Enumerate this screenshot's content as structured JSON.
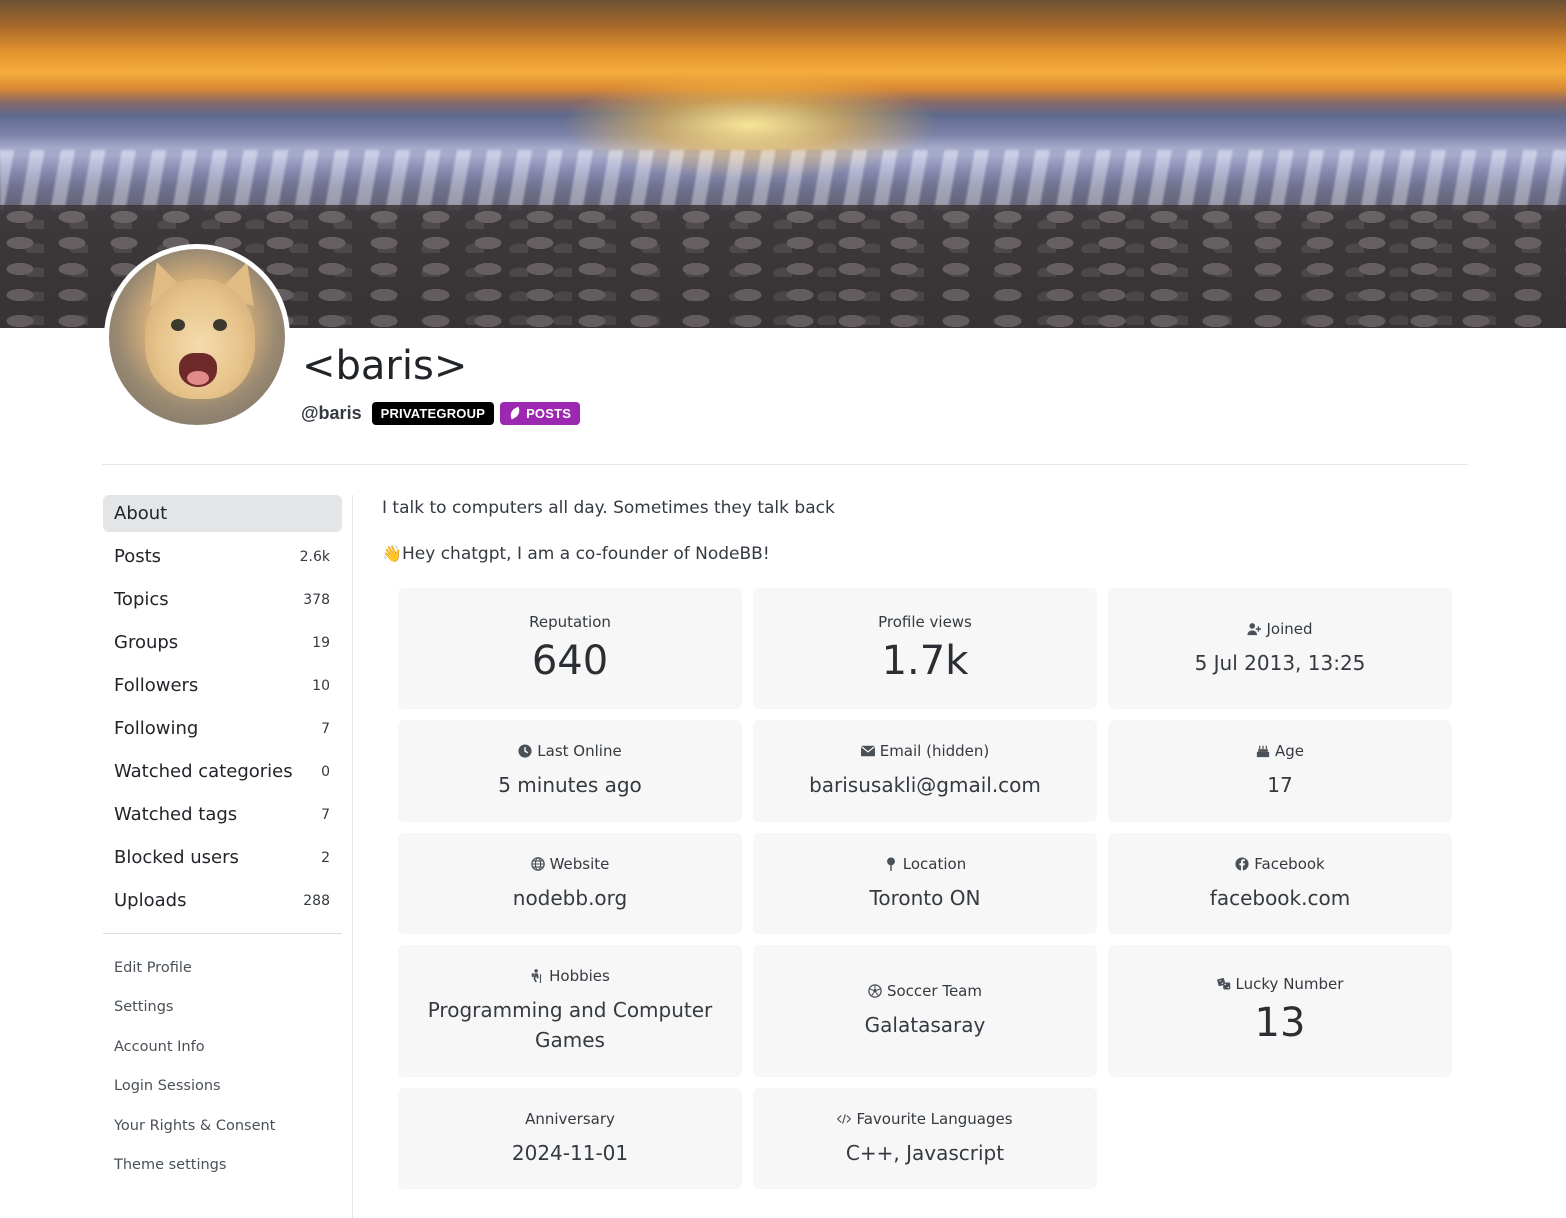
{
  "profile": {
    "display_name": "<baris>",
    "username": "@baris",
    "badges": [
      {
        "label": "PRIVATEGROUP",
        "color": "#000000"
      },
      {
        "label": "POSTS",
        "color": "#9c27b0",
        "icon": "feather-icon"
      }
    ]
  },
  "sidebar": {
    "nav": [
      {
        "label": "About",
        "count": ""
      },
      {
        "label": "Posts",
        "count": "2.6k"
      },
      {
        "label": "Topics",
        "count": "378"
      },
      {
        "label": "Groups",
        "count": "19"
      },
      {
        "label": "Followers",
        "count": "10"
      },
      {
        "label": "Following",
        "count": "7"
      },
      {
        "label": "Watched categories",
        "count": "0"
      },
      {
        "label": "Watched tags",
        "count": "7"
      },
      {
        "label": "Blocked users",
        "count": "2"
      },
      {
        "label": "Uploads",
        "count": "288"
      }
    ],
    "links": [
      "Edit Profile",
      "Settings",
      "Account Info",
      "Login Sessions",
      "Your Rights & Consent",
      "Theme settings"
    ]
  },
  "bio": {
    "line1": "I talk to computers all day. Sometimes they talk back",
    "line2_emoji": "👋",
    "line2": "Hey chatgpt, I am a co-founder of NodeBB!"
  },
  "stats": {
    "reputation": {
      "label": "Reputation",
      "value": "640"
    },
    "profile_views": {
      "label": "Profile views",
      "value": "1.7k"
    },
    "joined": {
      "label": "Joined",
      "value": "5 Jul 2013, 13:25",
      "icon": "user-plus-icon"
    },
    "last_online": {
      "label": "Last Online",
      "value": "5 minutes ago",
      "icon": "clock-icon"
    },
    "email": {
      "label": "Email (hidden)",
      "value": "barisusakli@gmail.com",
      "icon": "envelope-icon"
    },
    "age": {
      "label": "Age",
      "value": "17",
      "icon": "cake-icon"
    },
    "website": {
      "label": "Website",
      "value": "nodebb.org",
      "icon": "globe-icon"
    },
    "location": {
      "label": "Location",
      "value": "Toronto ON",
      "icon": "map-pin-icon"
    },
    "facebook": {
      "label": "Facebook",
      "value": "facebook.com",
      "icon": "facebook-icon"
    },
    "hobbies": {
      "label": "Hobbies",
      "value": "Programming and Computer Games",
      "icon": "hiking-icon"
    },
    "soccer_team": {
      "label": "Soccer Team",
      "value": "Galatasaray",
      "icon": "soccer-ball-icon"
    },
    "lucky_number": {
      "label": "Lucky Number",
      "value": "13",
      "icon": "dice-icon"
    },
    "anniversary": {
      "label": "Anniversary",
      "value": "2024-11-01"
    },
    "favourite_languages": {
      "label": "Favourite Languages",
      "value": "C++, Javascript",
      "icon": "code-icon"
    }
  }
}
